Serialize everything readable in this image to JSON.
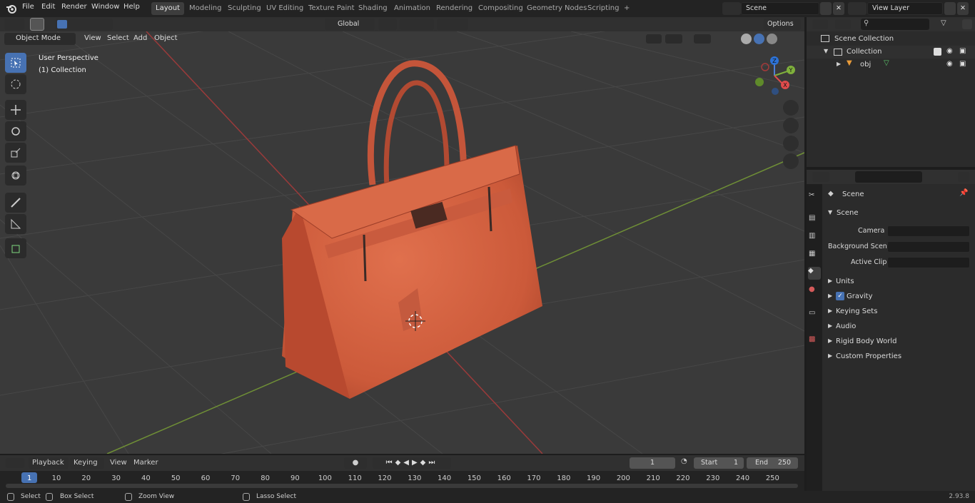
{
  "menus": {
    "file": "File",
    "edit": "Edit",
    "render": "Render",
    "window": "Window",
    "help": "Help"
  },
  "workspaces": [
    "Layout",
    "Modeling",
    "Sculpting",
    "UV Editing",
    "Texture Paint",
    "Shading",
    "Animation",
    "Rendering",
    "Compositing",
    "Geometry Nodes",
    "Scripting"
  ],
  "active_workspace": "Layout",
  "scene_field": "Scene",
  "view_layer_field": "View Layer",
  "viewport": {
    "orientation": "Global",
    "options": "Options",
    "mode": "Object Mode",
    "menu_view": "View",
    "menu_select": "Select",
    "menu_add": "Add",
    "menu_object": "Object",
    "overlay_line1": "User Perspective",
    "overlay_line2": "(1) Collection",
    "gizmo_z": "Z",
    "gizmo_y": "Y",
    "gizmo_x": "X"
  },
  "outliner": {
    "root": "Scene Collection",
    "collection": "Collection",
    "object": "obj"
  },
  "properties": {
    "context": "Scene",
    "panel": "Scene",
    "camera_label": "Camera",
    "bg_scene_label": "Background Scene",
    "active_clip_label": "Active Clip",
    "sections": [
      "Units",
      "Gravity",
      "Keying Sets",
      "Audio",
      "Rigid Body World",
      "Custom Properties"
    ],
    "gravity_checked": true
  },
  "timeline": {
    "playback": "Playback",
    "keying": "Keying",
    "view": "View",
    "marker": "Marker",
    "current_frame": "1",
    "start_label": "Start",
    "start_value": "1",
    "end_label": "End",
    "end_value": "250",
    "ticks": [
      "1",
      "10",
      "20",
      "30",
      "40",
      "50",
      "60",
      "70",
      "80",
      "90",
      "100",
      "110",
      "120",
      "130",
      "140",
      "150",
      "160",
      "170",
      "180",
      "190",
      "200",
      "210",
      "220",
      "230",
      "240",
      "250"
    ]
  },
  "statusbar": {
    "select": "Select",
    "box_select": "Box Select",
    "zoom_view": "Zoom View",
    "lasso_select": "Lasso Select",
    "version": "2.93.8"
  },
  "colors": {
    "accent": "#4772b3",
    "x_axis": "#c0392b",
    "y_axis": "#7fb03c",
    "bag": "#d4603f"
  }
}
